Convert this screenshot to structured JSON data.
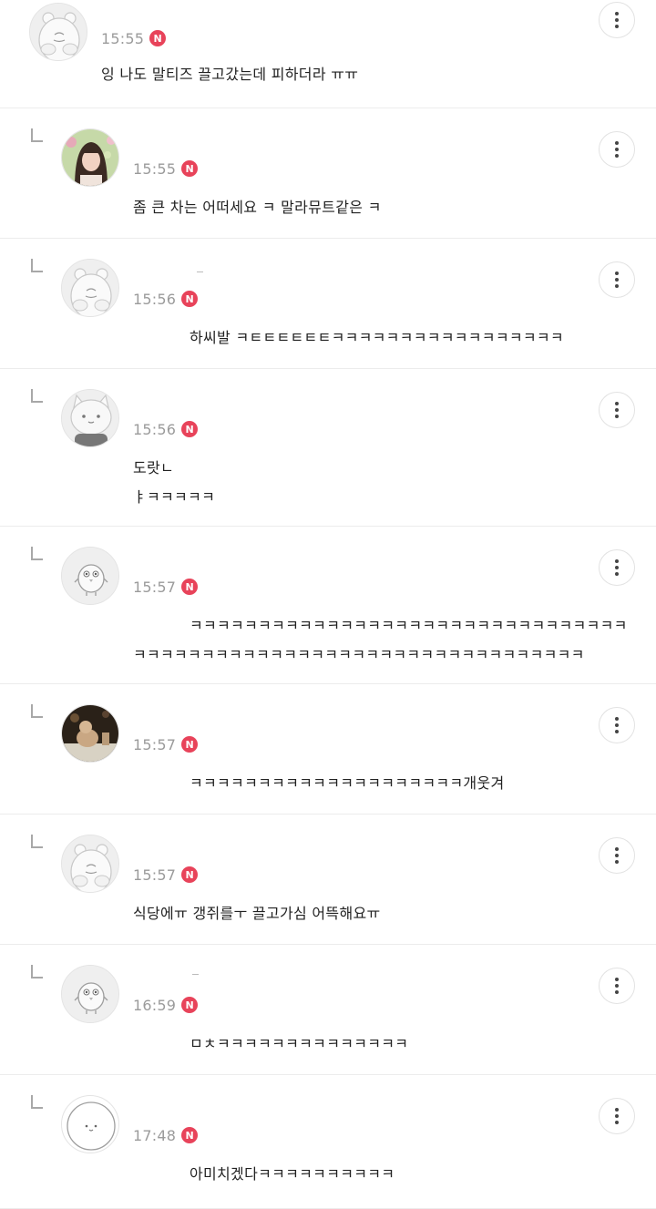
{
  "comments": [
    {
      "is_reply": false,
      "avatar": "hamster",
      "time": "15:55",
      "badge": "N",
      "lines": [
        "잉 나도 말티즈 끌고갔는데 피하더라 ㅠㅠ"
      ],
      "line_offsets": [
        0
      ]
    },
    {
      "is_reply": true,
      "avatar": "woman-photo",
      "time": "15:55",
      "badge": "N",
      "lines": [
        "좀 큰 차는 어떠세요 ㅋ 말라뮤트같은 ㅋ"
      ],
      "line_offsets": [
        0
      ]
    },
    {
      "is_reply": true,
      "avatar": "hamster",
      "time": "15:56",
      "badge": "N",
      "lines": [
        "하씨발 ㅋㅌㅌㅌㅌㅌㅌㅋㅋㅋㅋㅋㅋㅋㅋㅋㅋㅋㅋㅋㅋㅋㅋㅋ"
      ],
      "line_offsets": [
        62
      ]
    },
    {
      "is_reply": true,
      "avatar": "cat",
      "time": "15:56",
      "badge": "N",
      "lines": [
        "도랏ㄴ",
        "ㅑㅋㅋㅋㅋㅋ"
      ],
      "line_offsets": [
        0,
        0
      ]
    },
    {
      "is_reply": true,
      "avatar": "chick",
      "time": "15:57",
      "badge": "N",
      "lines": [
        "ㅋㅋㅋㅋㅋㅋㅋㅋㅋㅋㅋㅋㅋㅋㅋㅋㅋㅋㅋㅋㅋㅋㅋㅋㅋㅋㅋㅋㅋㅋㅋㅋ",
        "ㅋㅋㅋㅋㅋㅋㅋㅋㅋㅋㅋㅋㅋㅋㅋㅋㅋㅋㅋㅋㅋㅋㅋㅋㅋㅋㅋㅋㅋㅋㅋㅋㅋ"
      ],
      "line_offsets": [
        62,
        0
      ]
    },
    {
      "is_reply": true,
      "avatar": "dog-photo",
      "time": "15:57",
      "badge": "N",
      "lines": [
        "ㅋㅋㅋㅋㅋㅋㅋㅋㅋㅋㅋㅋㅋㅋㅋㅋㅋㅋㅋㅋ개웃겨"
      ],
      "line_offsets": [
        62
      ]
    },
    {
      "is_reply": true,
      "avatar": "hamster",
      "time": "15:57",
      "badge": "N",
      "lines": [
        "식당에ㅠ 갱쥐를ㅜ 끌고가심 어뜩해요ㅠ"
      ],
      "line_offsets": [
        0
      ]
    },
    {
      "is_reply": true,
      "avatar": "chick",
      "time": "16:59",
      "badge": "N",
      "lines": [
        "ㅁㅊㅋㅋㅋㅋㅋㅋㅋㅋㅋㅋㅋㅋㅋㅋ"
      ],
      "line_offsets": [
        62
      ]
    },
    {
      "is_reply": true,
      "avatar": "blob",
      "time": "17:48",
      "badge": "N",
      "lines": [
        "아미치겠다ㅋㅋㅋㅋㅋㅋㅋㅋㅋㅋ"
      ],
      "line_offsets": [
        62
      ]
    }
  ]
}
